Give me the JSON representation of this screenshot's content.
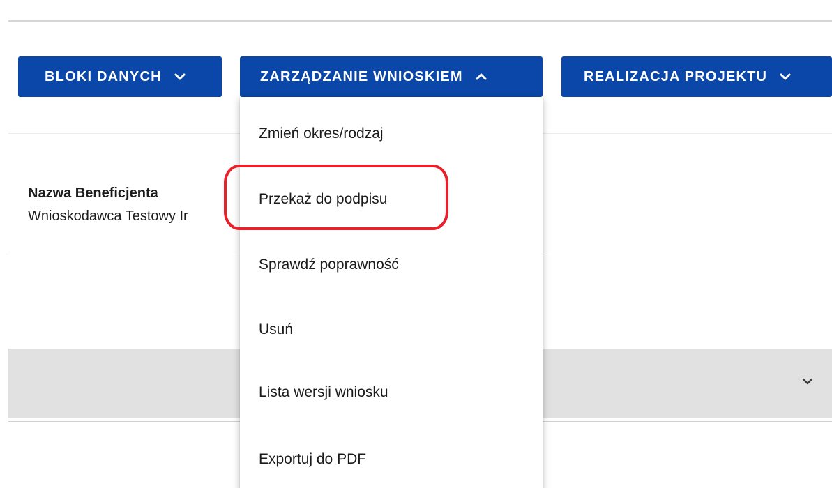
{
  "toolbar": {
    "bloki_label": "BLOKI DANYCH",
    "zarzadzanie_label": "ZARZĄDZANIE WNIOSKIEM",
    "realizacja_label": "REALIZACJA PROJEKTU"
  },
  "beneficiary": {
    "title": "Nazwa Beneficjenta",
    "value": "Wnioskodawca Testowy Ir"
  },
  "dropdown_menu": {
    "items": [
      "Zmień okres/rodzaj",
      "Przekaż do podpisu",
      "Sprawdź poprawność",
      "Usuń",
      "Lista wersji wniosku",
      "Exportuj do PDF"
    ],
    "highlighted_index": 1
  },
  "colors": {
    "primary_button": "#0b47a8",
    "highlight_outline": "#e8202a",
    "band_background": "#e1e1e1"
  },
  "icons": {
    "button_chevron_collapsed": "chevron-down-icon",
    "button_chevron_expanded": "chevron-up-icon",
    "section_chevron": "chevron-down-icon"
  }
}
